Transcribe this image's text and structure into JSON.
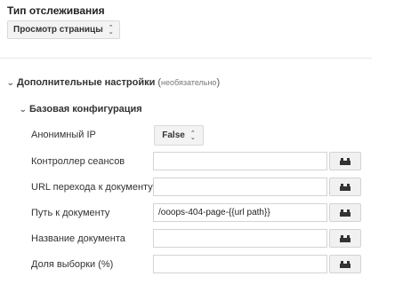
{
  "tracking": {
    "title": "Тип отслеживания",
    "select_value": "Просмотр страницы"
  },
  "advanced": {
    "label": "Дополнительные настройки",
    "optional_open": "(",
    "optional_text": "необязательно",
    "optional_close": ")"
  },
  "base_config": {
    "label": "Базовая конфигурация",
    "rows": [
      {
        "label": "Анонимный IP",
        "value": "False"
      },
      {
        "label": "Контроллер сеансов",
        "value": ""
      },
      {
        "label": "URL перехода к документу",
        "value": ""
      },
      {
        "label": "Путь к документу",
        "value": "/ooops-404-page-{{url path}}"
      },
      {
        "label": "Название документа",
        "value": ""
      },
      {
        "label": "Доля выборки (%)",
        "value": ""
      }
    ]
  },
  "icons": {
    "variable_picker": "lego-brick-icon",
    "select_arrows": "up-down-arrows-icon",
    "expand": "chevron-down-icon"
  }
}
